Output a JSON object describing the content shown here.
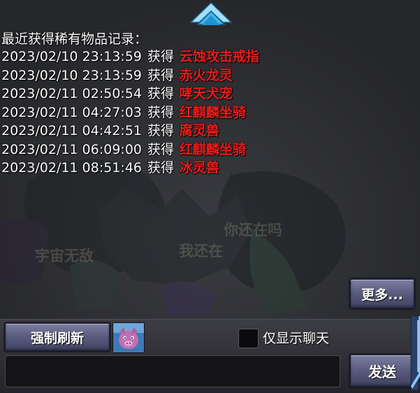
{
  "log": {
    "title": "最近获得稀有物品记录：",
    "verb": "获得",
    "entries": [
      {
        "time": "2023/02/10 23:13:59",
        "item": "云蚀攻击戒指"
      },
      {
        "time": "2023/02/10 23:13:59",
        "item": "赤火龙灵"
      },
      {
        "time": "2023/02/11 02:50:54",
        "item": "哮天犬宠"
      },
      {
        "time": "2023/02/11 04:27:03",
        "item": "红麒麟坐骑"
      },
      {
        "time": "2023/02/11 04:42:51",
        "item": "腐灵兽"
      },
      {
        "time": "2023/02/11 06:09:00",
        "item": "红麒麟坐骑"
      },
      {
        "time": "2023/02/11 08:51:46",
        "item": "冰灵兽"
      }
    ]
  },
  "background_chat": {
    "bubble_1": "你还在吗",
    "bubble_2": "我还在",
    "bubble_3": "宇宙无敌"
  },
  "buttons": {
    "more": "更多...",
    "refresh": "强制刷新",
    "send": "发送"
  },
  "chat_only": {
    "label": "仅显示聊天",
    "checked": false
  },
  "chat_input": {
    "value": ""
  },
  "colors": {
    "item_text": "#e81c1c",
    "log_text": "#ffffff",
    "button_face": "#5b5e80",
    "arrow": "#3fb7ee"
  },
  "icons": {
    "collapse": "chevron-up-icon",
    "avatar": "pig-avatar-icon",
    "scroll": "scroll-handle-icon"
  }
}
